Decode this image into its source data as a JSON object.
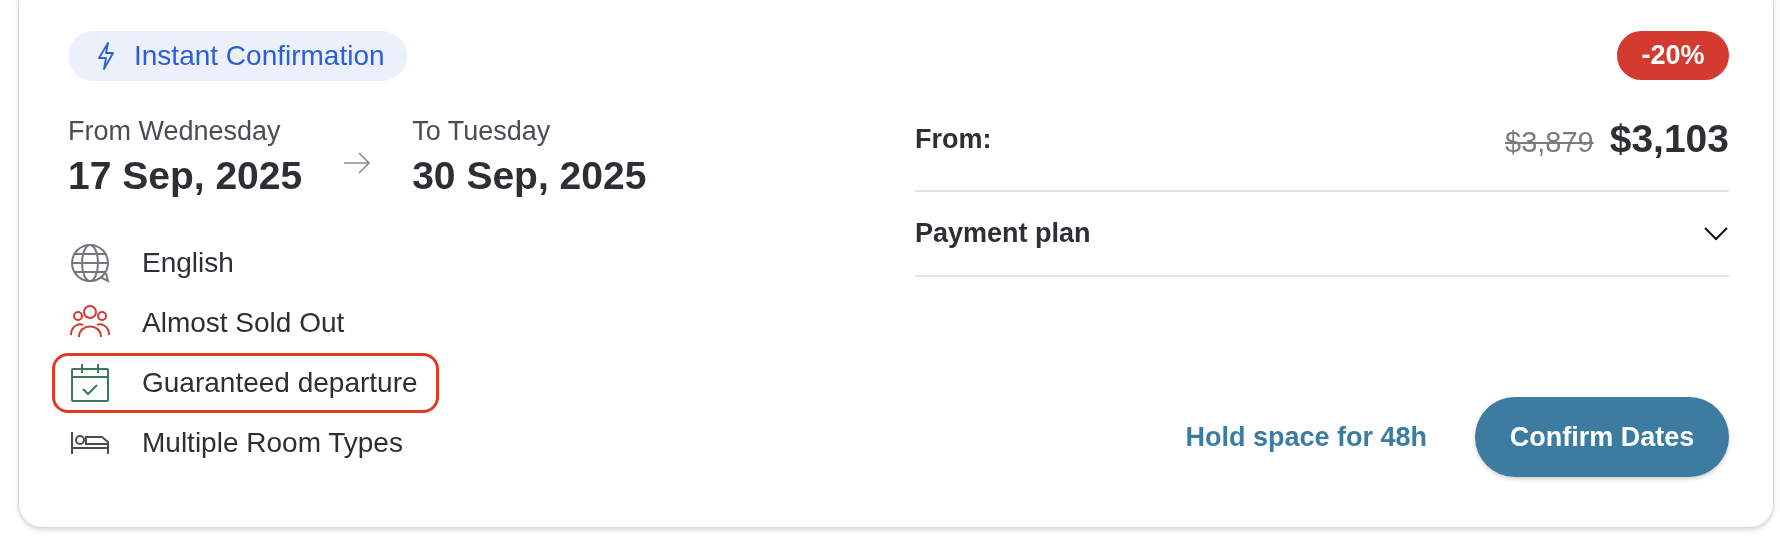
{
  "badge": {
    "label": "Instant Confirmation"
  },
  "dates": {
    "from_label": "From Wednesday",
    "from_date": "17 Sep, 2025",
    "to_label": "To Tuesday",
    "to_date": "30 Sep, 2025"
  },
  "features": [
    {
      "kind": "language",
      "label": "English",
      "highlighted": false
    },
    {
      "kind": "availability",
      "label": "Almost Sold Out",
      "highlighted": false
    },
    {
      "kind": "departure",
      "label": "Guaranteed departure",
      "highlighted": true
    },
    {
      "kind": "rooms",
      "label": "Multiple Room Types",
      "highlighted": false
    }
  ],
  "discount": "-20%",
  "price": {
    "label": "From:",
    "old_price": "$3,879",
    "new_price": "$3,103"
  },
  "payment_plan": {
    "label": "Payment plan",
    "expanded": false
  },
  "hold_link": "Hold space for 48h",
  "confirm_button": "Confirm Dates"
}
